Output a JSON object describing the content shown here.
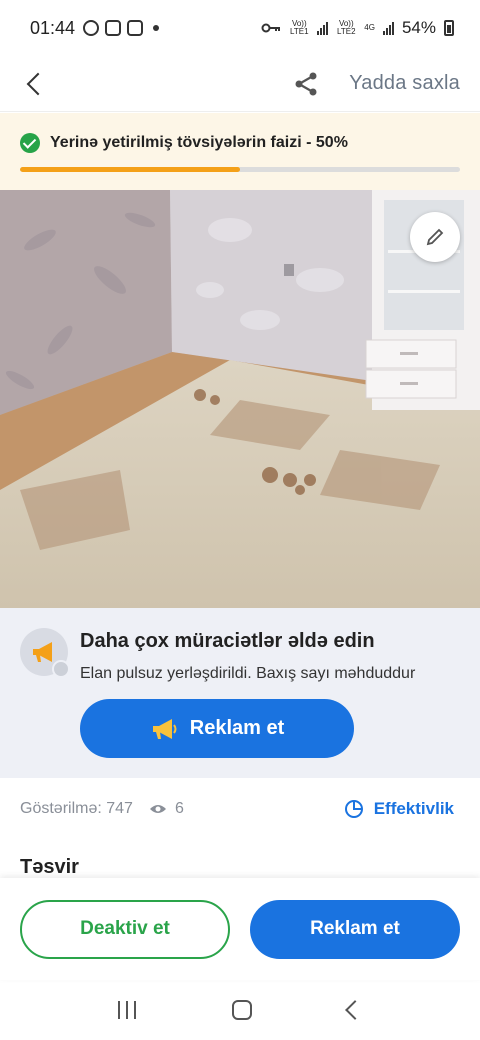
{
  "status_bar": {
    "time": "01:44",
    "net1": "Vo)) LTE1",
    "net2": "Vo)) LTE2",
    "net2_tag": "4G",
    "battery": "54%"
  },
  "top_bar": {
    "save_label": "Yadda saxla"
  },
  "progress": {
    "label": "Yerinə yetirilmiş tövsiyələrin faizi - 50%",
    "fraction": 0.5,
    "color": "#f4a018"
  },
  "promo": {
    "title": "Daha çox müraciətlər əldə edin",
    "subtitle": "Elan pulsuz yerləşdirildi. Baxış sayı məhduddur",
    "button_label": "Reklam et"
  },
  "stats": {
    "impressions": "Göstərilmə: 747",
    "views": "6",
    "effectiveness_label": "Effektivlik"
  },
  "description": {
    "title": "Təsvir"
  },
  "actions": {
    "deactivate_label": "Deaktiv et",
    "advertise_label": "Reklam et"
  },
  "colors": {
    "primary": "#1a73e0",
    "success": "#2aa44a",
    "progress": "#f4a018"
  }
}
